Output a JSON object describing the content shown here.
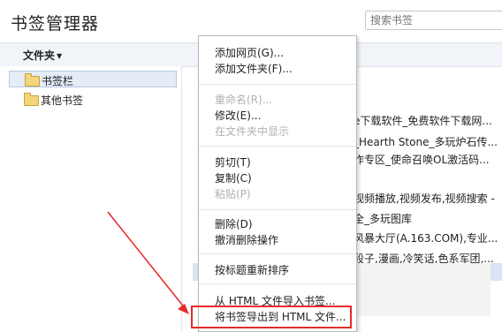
{
  "app": {
    "title": "书签管理器"
  },
  "search": {
    "placeholder": "搜索书签"
  },
  "toolbar": {
    "folders_label": "文件夹"
  },
  "tree": {
    "items": [
      {
        "label": "书签栏",
        "selected": true
      },
      {
        "label": "其他书签",
        "selected": false
      }
    ]
  },
  "list": {
    "items": [
      "e下载软件_免费软件下载网...",
      "_Hearth Stone_多玩炉石传...",
      "作专区_使命召唤OL激活码...",
      "视频播放,视频发布,视频搜索 -",
      "全_多玩图库",
      "风暴大厅(A.163.COM),专业...",
      "段子,漫画,冷笑话,色系军团,..."
    ]
  },
  "menu": {
    "add_page": "添加网页(G)...",
    "add_folder": "添加文件夹(F)...",
    "rename": "重命名(R)...",
    "edit": "修改(E)...",
    "show_in_folder": "在文件夹中显示",
    "cut": "剪切(T)",
    "copy": "复制(C)",
    "paste": "粘贴(P)",
    "delete": "删除(D)",
    "undo_delete": "撤消删除操作",
    "reorder_by_title": "按标题重新排序",
    "import_html": "从 HTML 文件导入书签...",
    "export_html": "将书签导出到 HTML 文件..."
  },
  "colors": {
    "annotation_red": "#e8292b",
    "selected_bg": "#e4ecf7",
    "toolbar_bg": "#f1f4f8"
  }
}
